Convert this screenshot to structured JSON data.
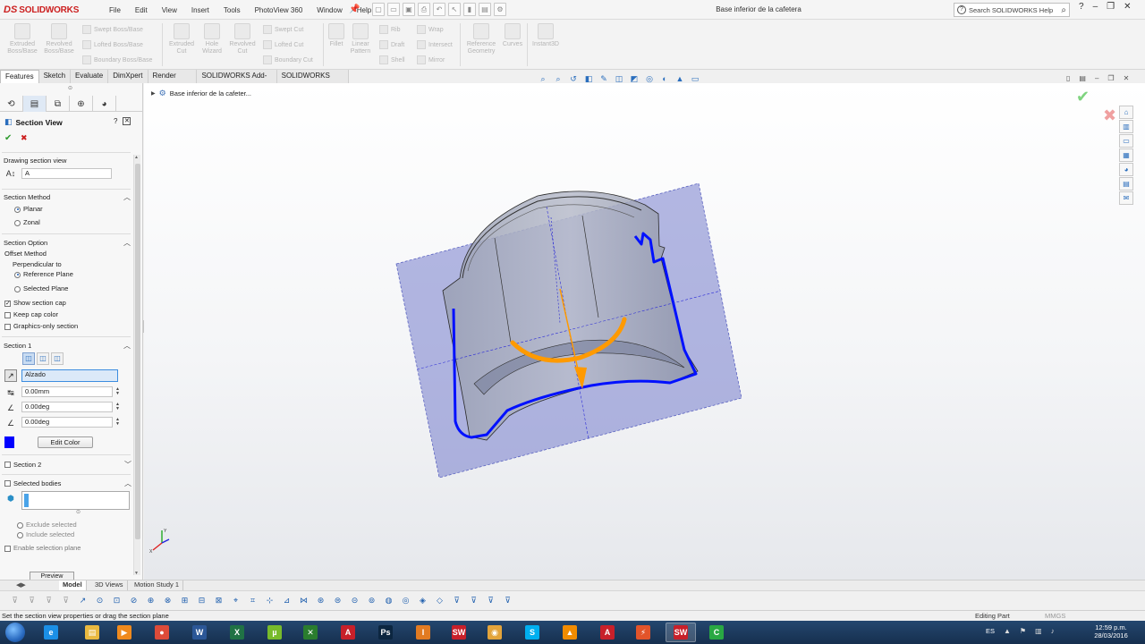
{
  "app": {
    "logo_mark": "DS",
    "logo_text": "SOLIDWORKS",
    "menus": [
      "File",
      "Edit",
      "View",
      "Insert",
      "Tools",
      "PhotoView 360",
      "Window",
      "Help"
    ],
    "document_title": "Base inferior de la cafetera",
    "search_placeholder": "Search SOLIDWORKS Help",
    "search_help_glyph": "?"
  },
  "ribbon": {
    "extruded_boss": "Extruded Boss/Base",
    "revolved_boss": "Revolved Boss/Base",
    "swept_boss": "Swept Boss/Base",
    "lofted_boss": "Lofted Boss/Base",
    "boundary_boss": "Boundary Boss/Base",
    "extruded_cut": "Extruded Cut",
    "hole_wizard": "Hole Wizard",
    "revolved_cut": "Revolved Cut",
    "swept_cut": "Swept Cut",
    "lofted_cut": "Lofted Cut",
    "boundary_cut": "Boundary Cut",
    "fillet": "Fillet",
    "linear_pattern": "Linear Pattern",
    "rib": "Rib",
    "draft": "Draft",
    "shell": "Shell",
    "wrap": "Wrap",
    "intersect": "Intersect",
    "mirror": "Mirror",
    "reference_geometry": "Reference Geometry",
    "curves": "Curves",
    "instant3d": "Instant3D"
  },
  "tabs": [
    "Features",
    "Sketch",
    "Evaluate",
    "DimXpert",
    "Render Tools",
    "SOLIDWORKS Add-Ins",
    "SOLIDWORKS MBD"
  ],
  "property_manager": {
    "title": "Section View",
    "help_glyph": "?",
    "ok_glyph": "✔",
    "cancel_glyph": "✖",
    "drawing_section_view": {
      "header": "Drawing section view",
      "value": "A"
    },
    "section_method": {
      "header": "Section Method",
      "options": [
        "Planar",
        "Zonal"
      ],
      "selected": "Planar"
    },
    "section_option": {
      "header": "Section Option",
      "offset_method": "Offset Method",
      "perpendicular_to": "Perpendicular to",
      "reference_plane": "Reference Plane",
      "selected_plane": "Selected Plane",
      "show_section_cap": "Show section cap",
      "keep_cap_color": "Keep cap color",
      "graphics_only": "Graphics-only section"
    },
    "section1": {
      "header": "Section 1",
      "plane": "Alzado",
      "offset": "0.00mm",
      "rotation_x": "0.00deg",
      "rotation_y": "0.00deg",
      "edit_color": "Edit Color",
      "cap_color": "#0000ff"
    },
    "section2": {
      "header": "Section 2"
    },
    "selected_bodies": {
      "header": "Selected bodies",
      "exclude": "Exclude selected",
      "include": "Include selected"
    },
    "enable_selection_plane": "Enable selection plane",
    "preview": "Preview"
  },
  "graphics": {
    "tree_item": "Base inferior de la cafeter...",
    "section_plane_color": "#6a72c8",
    "cap_outline_color": "#0010ff",
    "handle_color": "#ff9a00",
    "triad": {
      "x": "X",
      "y": "Y"
    }
  },
  "bottom_tabs": [
    "Model",
    "3D Views",
    "Motion Study 1"
  ],
  "status": {
    "message": "Set the section view properties or drag the section plane",
    "mode": "Editing Part",
    "units": "MMGS"
  },
  "taskbar": {
    "language": "ES",
    "time": "12:59 p.m.",
    "date": "28/03/2016",
    "apps": [
      {
        "name": "internet-explorer",
        "glyph": "e",
        "color": "#1b8fe6"
      },
      {
        "name": "file-explorer",
        "glyph": "▤",
        "color": "#e9b940"
      },
      {
        "name": "media-player",
        "glyph": "▶",
        "color": "#f08a1d"
      },
      {
        "name": "chrome",
        "glyph": "●",
        "color": "#dd4b39"
      },
      {
        "name": "word",
        "glyph": "W",
        "color": "#2b5797"
      },
      {
        "name": "excel",
        "glyph": "X",
        "color": "#207245"
      },
      {
        "name": "utorrent",
        "glyph": "µ",
        "color": "#78bb2b"
      },
      {
        "name": "app-xx",
        "glyph": "✕",
        "color": "#2a7d2e"
      },
      {
        "name": "autocad",
        "glyph": "A",
        "color": "#c8202a"
      },
      {
        "name": "photoshop",
        "glyph": "Ps",
        "color": "#0c2640"
      },
      {
        "name": "app-i",
        "glyph": "I",
        "color": "#e27b22"
      },
      {
        "name": "solidworks-2016",
        "glyph": "SW",
        "color": "#c8202a"
      },
      {
        "name": "app-ball",
        "glyph": "◉",
        "color": "#e3a43b"
      },
      {
        "name": "skype",
        "glyph": "S",
        "color": "#00aff0"
      },
      {
        "name": "vlc",
        "glyph": "▲",
        "color": "#f28c00"
      },
      {
        "name": "acrobat",
        "glyph": "A",
        "color": "#c8202a"
      },
      {
        "name": "app-bolt",
        "glyph": "⚡",
        "color": "#e2542a"
      },
      {
        "name": "solidworks-2016-active",
        "glyph": "SW",
        "color": "#c8202a"
      },
      {
        "name": "camtasia",
        "glyph": "C",
        "color": "#29a843"
      }
    ]
  }
}
